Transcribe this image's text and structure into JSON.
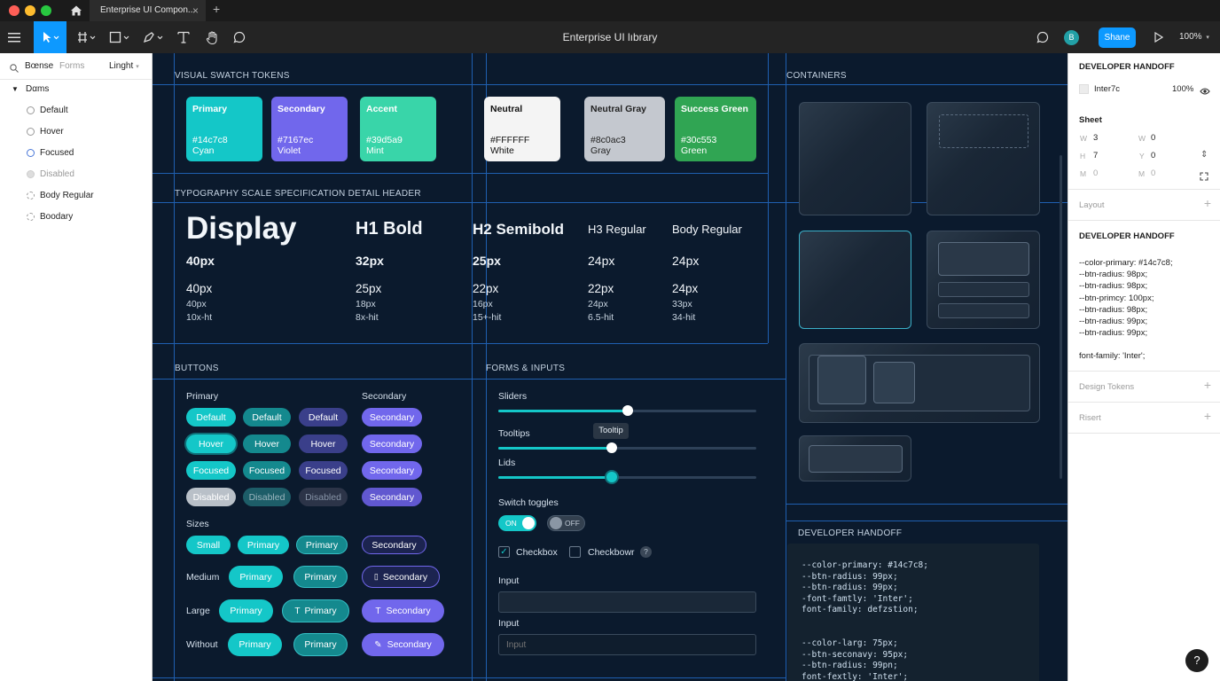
{
  "titlebar": {
    "tab_title": "Enterprise UI Compon...",
    "tab_close": "×",
    "new_tab": "+"
  },
  "toolbar": {
    "doc_title": "Enterprise UI lıbrary",
    "share_label": "Shane",
    "zoom": "100%",
    "avatar_initial": "B"
  },
  "layers": {
    "tab_active": "Bœnse",
    "tab_forms": "Forms",
    "theme": "Linght",
    "group": "Dαms",
    "items": [
      "Default",
      "Hover",
      "Focused",
      "Disabled",
      "Body Regular",
      "Boodary"
    ]
  },
  "canvas": {
    "swatch_header": "VISUAL SWATCH TOKENS",
    "typography_header": "TYPOGRAPHY SCALE SPECIFICATION DETAIL HEADER",
    "buttons_header": "BUTTONS",
    "forms_header": "FORMS & INPUTS",
    "containers_header": "CONTAINERS",
    "handoff_header": "DEVELOPER HANDOFF"
  },
  "swatches": [
    {
      "title": "Primary",
      "hex": "#14c7c8",
      "name": "Cyan",
      "color": "#14c7c8"
    },
    {
      "title": "Secondary",
      "hex": "#7167ec",
      "name": "Violet",
      "color": "#7167ec"
    },
    {
      "title": "Accent",
      "hex": "#39d5a9",
      "name": "Mint",
      "color": "#39d5a9"
    },
    {
      "title": "Neutral",
      "hex": "#FFFFFF",
      "name": "White",
      "color": "#f4f4f4"
    },
    {
      "title": "Neutral Gray",
      "hex": "#8c0ac3",
      "name": "Gray",
      "color": "#c4c8cf"
    },
    {
      "title": "Success Green",
      "hex": "#30c553",
      "name": "Green",
      "color": "#30a553"
    }
  ],
  "typography": [
    {
      "sample": "Display",
      "bold": "40px",
      "size": "40px",
      "sub": "40px",
      "meta": "10x-ht"
    },
    {
      "sample": "H1 Bold",
      "bold": "32px",
      "size": "25px",
      "sub": "18px",
      "meta": "8x-hit"
    },
    {
      "sample": "H2 Semibold",
      "bold": "25px",
      "size": "22px",
      "sub": "16px",
      "meta": "15+-hit"
    },
    {
      "sample": "H3 Regular",
      "bold": "24px",
      "size": "22px",
      "sub": "24px",
      "meta": "6.5-hit"
    },
    {
      "sample": "Body Regular",
      "bold": "24px",
      "size": "24px",
      "sub": "33px",
      "meta": "34-hit"
    }
  ],
  "buttons": {
    "primary_label": "Primary",
    "secondary_label": "Secondary",
    "default": "Default",
    "hover": "Hover",
    "focused": "Focused",
    "disabled": "Disabled",
    "secondary": "Secondary",
    "sizes_label": "Sizes",
    "small": "Small",
    "primary": "Primary",
    "medium_label": "Medium",
    "large_label": "Large",
    "without_label": "Without"
  },
  "forms": {
    "sliders_label": "Sliders",
    "tooltips_label": "Tooltips",
    "tooltip_text": "Tooltip",
    "lids_label": "Lids",
    "slider_values": [
      0.5,
      0.44,
      0.44
    ],
    "toggles_label": "Switch toggles",
    "toggle_on": "ON",
    "toggle_off": "OFF",
    "checkbox1": "Checkbox",
    "checkbox2": "Checkbowr",
    "help": "?",
    "input1_label": "Input",
    "input2_label": "Input",
    "input2_placeholder": "Input"
  },
  "handoff_code_1": "--color-primary: #14c7c8;\n--btn-radius: 99px;\n--btn-radius: 99px;\n-font-famtly: 'Inter';\nfont-family: defzstion;",
  "handoff_code_2": "--color-larg: 75px;\n--btn-seconavy: 95px;\n--btn-radius: 99pn;\nfont-fextly: 'Inter';",
  "inspector": {
    "header1": "DEVELOPER HANDOFF",
    "font_name": "Inter7c",
    "opacity": "100%",
    "sheet_label": "Sheet",
    "w_label": "W",
    "w_value": "3",
    "w2_label": "W",
    "w2_value": "0",
    "h_label": "H",
    "h_value": "7",
    "y_label": "Y",
    "y_value": "0",
    "m_label": "M",
    "m_value": "0",
    "m2_label": "M",
    "m2_value": "0",
    "layout_label": "Layout",
    "header2": "DEVELOPER HANDOFF",
    "code": "--color-primary: #14c7c8;\n--btn-radius: 98px;\n--btn-radius: 98px;\n--btn-primcy: 100px;\n--btn-radius: 98px;\n--btn-radius: 99px;\n--btn-radius: 99px;",
    "font_family": "font-family: 'Inter';",
    "design_tokens": "Design Tokens",
    "risert": "Risert"
  },
  "help_button": "?"
}
